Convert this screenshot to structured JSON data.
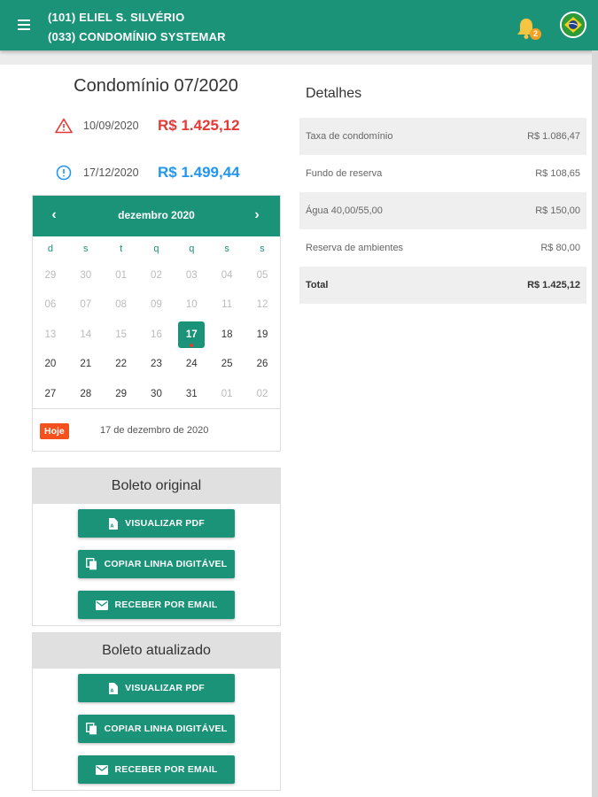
{
  "header": {
    "line1": "(101) ELIEL S. SILVÉRIO",
    "line2": "(033) CONDOMÍNIO SYSTEMAR",
    "notification_count": "2",
    "brand_green": "#1a9379"
  },
  "main": {
    "title": "Condomínio 07/2020",
    "due_original": {
      "date": "10/09/2020",
      "value": "R$ 1.425,12",
      "icon": "warning-icon"
    },
    "due_updated": {
      "date": "17/12/2020",
      "value": "R$ 1.499,44",
      "icon": "info-icon"
    }
  },
  "calendar": {
    "month_label": "dezembro 2020",
    "weekdays": [
      "d",
      "s",
      "t",
      "q",
      "q",
      "s",
      "s"
    ],
    "weeks": [
      [
        "29",
        "30",
        "01",
        "02",
        "03",
        "04",
        "05"
      ],
      [
        "06",
        "07",
        "08",
        "09",
        "10",
        "11",
        "12"
      ],
      [
        "13",
        "14",
        "15",
        "16",
        "17",
        "18",
        "19"
      ],
      [
        "20",
        "21",
        "22",
        "23",
        "24",
        "25",
        "26"
      ],
      [
        "27",
        "28",
        "29",
        "30",
        "31",
        "01",
        "02"
      ]
    ],
    "today_badge": "Hoje",
    "today_text": "17 de dezembro de 2020"
  },
  "boleto_original": {
    "title": "Boleto original",
    "pdf_label": "VISUALIZAR PDF",
    "copy_label": "COPIAR LINHA DIGITÁVEL",
    "email_label": "RECEBER POR EMAIL"
  },
  "boleto_atualizado": {
    "title": "Boleto atualizado",
    "pdf_label": "VISUALIZAR PDF",
    "copy_label": "COPIAR LINHA DIGITÁVEL",
    "email_label": "RECEBER POR EMAIL"
  },
  "details": {
    "title": "Detalhes",
    "rows": [
      {
        "label": "Taxa de condomínio",
        "value": "R$ 1.086,47"
      },
      {
        "label": "Fundo de reserva",
        "value": "R$ 108,65"
      },
      {
        "label": "Água 40,00/55,00",
        "value": "R$ 150,00"
      },
      {
        "label": "Reserva de ambientes",
        "value": "R$ 80,00"
      },
      {
        "label": "Total",
        "value": "R$ 1.425,12"
      }
    ]
  }
}
